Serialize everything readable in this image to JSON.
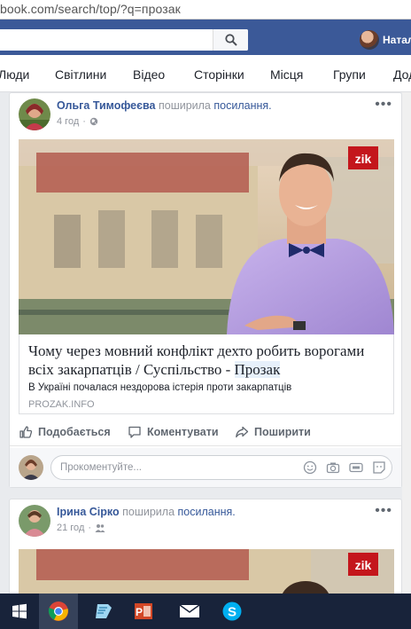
{
  "browser": {
    "url": "book.com/search/top/?q=прозак"
  },
  "header": {
    "user_name": "Натал"
  },
  "tabs": [
    "Люди",
    "Світлини",
    "Відео",
    "Сторінки",
    "Місця",
    "Групи",
    "Дод"
  ],
  "posts": [
    {
      "author": "Ольга Тимофеєва",
      "verb": "поширила",
      "object": "посилання.",
      "time": "4 год",
      "link": {
        "badge": "zik",
        "title_main": "Чому через мовний конфлікт дехто робить ворогами всіх закарпатців / Суспільство - ",
        "title_highlight": "Прозак",
        "description": "В Україні почалася нездорова істерія проти закарпатців",
        "source": "PROZAK.INFO"
      },
      "actions": {
        "like": "Подобається",
        "comment": "Коментувати",
        "share": "Поширити"
      },
      "comment_placeholder": "Прокоментуйте..."
    },
    {
      "author": "Ірина Сірко",
      "verb": "поширила",
      "object": "посилання.",
      "time": "21 год",
      "link": {
        "badge": "zik"
      }
    }
  ],
  "icons": {
    "search": "search-icon",
    "globe": "globe-icon",
    "friends": "friends-icon",
    "like": "thumbs-up-icon",
    "comment": "comment-icon",
    "share": "share-icon",
    "emoji": "emoji-icon",
    "camera": "camera-icon",
    "gif": "gif-icon",
    "sticker": "sticker-icon",
    "taskbar": [
      "windows-start-icon",
      "chrome-icon",
      "notepad-icon",
      "powerpoint-icon",
      "mail-icon",
      "skype-icon"
    ]
  },
  "colors": {
    "fb_blue": "#3b5998",
    "link_blue": "#365899",
    "zik_red": "#c4161c",
    "taskbar": "#18233a"
  }
}
